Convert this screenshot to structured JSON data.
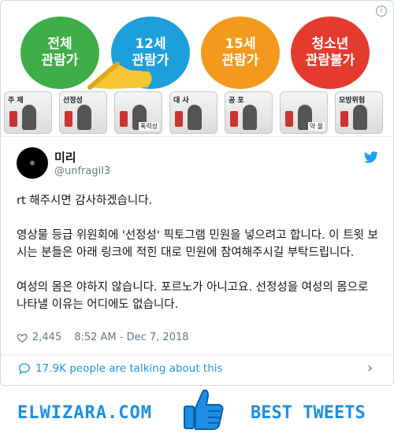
{
  "media": {
    "ratings": [
      {
        "label": "전체\n관람가",
        "color": "#3fae49"
      },
      {
        "label": "12세\n관람가",
        "color": "#1d9fdc"
      },
      {
        "label": "15세\n관람가",
        "color": "#f39a1e"
      },
      {
        "label": "청소년\n관람불가",
        "color": "#e53b2f"
      }
    ],
    "pictograms": [
      {
        "label": "주 제",
        "sub": ""
      },
      {
        "label": "선정성",
        "sub": ""
      },
      {
        "label": "",
        "sub": "폭력성"
      },
      {
        "label": "대 사",
        "sub": ""
      },
      {
        "label": "공 포",
        "sub": ""
      },
      {
        "label": "",
        "sub": "약 물"
      },
      {
        "label": "모방위험",
        "sub": ""
      }
    ]
  },
  "author": {
    "name": "미리",
    "handle": "@unfragil3"
  },
  "tweet": {
    "paragraphs": [
      "rt 해주시면 감사하겠습니다.",
      "영상물 등급 위원회에 '선정성' 픽토그램 민원을 넣으려고 합니다. 이 트윗 보시는 분들은 아래 링크에 적힌 대로 민원에 참여해주시길 부탁드립니다.",
      "여성의 몸은 야하지 않습니다. 포르노가 아니고요. 선정성을 여성의 몸으로 나타낼 이유는 어디에도 없습니다."
    ]
  },
  "meta": {
    "likes": "2,445",
    "timestamp": "8:52 AM - Dec 7, 2018"
  },
  "talking": "17.9K people are talking about this",
  "footer": {
    "site": "ELWIZARA.COM",
    "tagline": "BEST TWEETS"
  }
}
